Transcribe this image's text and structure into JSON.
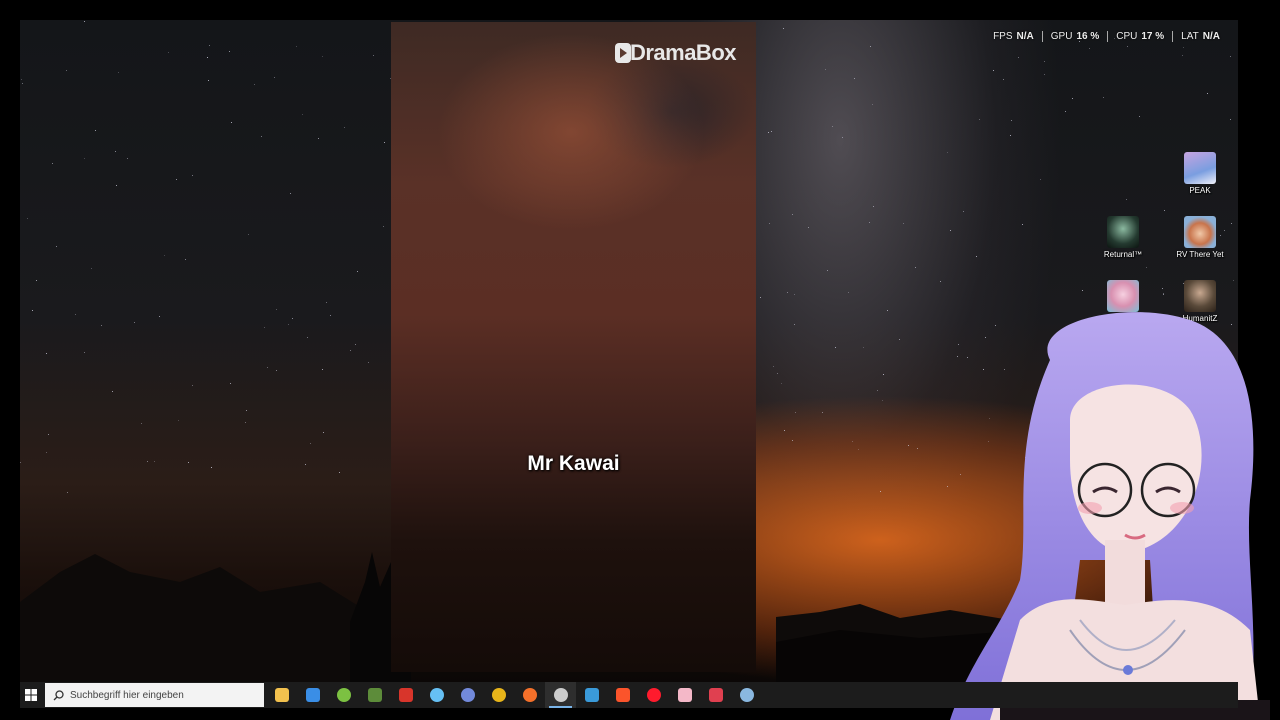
{
  "video": {
    "logo": "DramaBox",
    "subtitle": "Mr Kawai"
  },
  "perf": [
    {
      "label": "FPS",
      "value": "N/A"
    },
    {
      "label": "GPU",
      "value": "16 %"
    },
    {
      "label": "CPU",
      "value": "17 %"
    },
    {
      "label": "LAT",
      "value": "N/A"
    }
  ],
  "desktop_icons": [
    {
      "label": "PEAK",
      "color": "#8aa6d6"
    },
    {
      "label": "Returnal™",
      "color": "#2f4a3c"
    },
    {
      "label": "RV There Yet",
      "color": "#c8744c"
    },
    {
      "label": "",
      "color": "#d890b0"
    },
    {
      "label": "HumanitZ",
      "color": "#5a4a3a"
    }
  ],
  "taskbar": {
    "search_placeholder": "Suchbegriff hier eingeben",
    "apps": [
      {
        "icon": "file-explorer-icon",
        "color": "#f2c14e"
      },
      {
        "icon": "store-icon",
        "color": "#3a8ee6"
      },
      {
        "icon": "android-icon",
        "color": "#7cc142"
      },
      {
        "icon": "minecraft-icon",
        "color": "#5d8c3a"
      },
      {
        "icon": "media-app-icon",
        "color": "#d8352b"
      },
      {
        "icon": "steam-icon",
        "color": "#66c0f4"
      },
      {
        "icon": "discord-icon",
        "color": "#7289da"
      },
      {
        "icon": "chrome-icon",
        "color": "#e8b51a"
      },
      {
        "icon": "firefox-icon",
        "color": "#f4702a"
      },
      {
        "icon": "obs-icon",
        "color": "#cccccc"
      },
      {
        "icon": "app-blue-icon",
        "color": "#3a9ad9"
      },
      {
        "icon": "brave-icon",
        "color": "#fb542b"
      },
      {
        "icon": "opera-icon",
        "color": "#ff1b2d"
      },
      {
        "icon": "pink-app-icon",
        "color": "#f4b8c8"
      },
      {
        "icon": "red-bar-icon",
        "color": "#e04050"
      },
      {
        "icon": "steam-link-icon",
        "color": "#8ab8e0"
      }
    ],
    "active_index": 9
  }
}
